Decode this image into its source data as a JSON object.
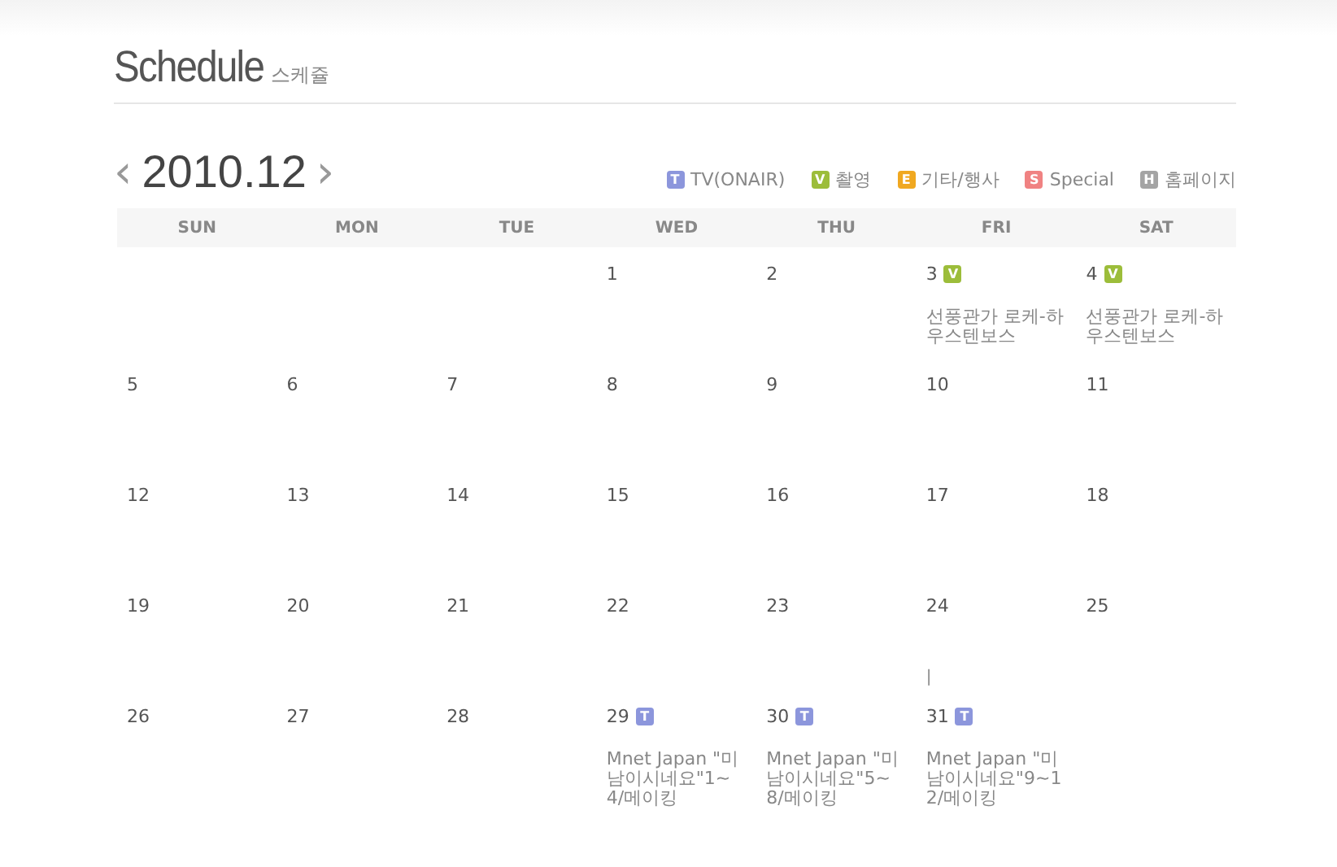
{
  "title": "Schedule",
  "subtitle": "스케쥴",
  "month": {
    "prev": "‹",
    "label": "2010.12",
    "next": "›"
  },
  "legend": [
    {
      "letter": "T",
      "label": "TV(ONAIR)",
      "color": "#8c96dc"
    },
    {
      "letter": "V",
      "label": "촬영",
      "color": "#9cbd3a"
    },
    {
      "letter": "E",
      "label": "기타/행사",
      "color": "#f0a820"
    },
    {
      "letter": "S",
      "label": "Special",
      "color": "#f08282"
    },
    {
      "letter": "H",
      "label": "홈페이지",
      "color": "#a4a4a4"
    }
  ],
  "weekdays": [
    "SUN",
    "MON",
    "TUE",
    "WED",
    "THU",
    "FRI",
    "SAT"
  ],
  "days": [
    {
      "day": "1"
    },
    {
      "day": "2"
    },
    {
      "day": "3",
      "badge": {
        "letter": "V",
        "color": "#9cbd3a"
      },
      "event": "선풍관가 로케-하우스텐보스"
    },
    {
      "day": "4",
      "badge": {
        "letter": "V",
        "color": "#9cbd3a"
      },
      "event": "선풍관가 로케-하우스텐보스"
    },
    {
      "day": "5"
    },
    {
      "day": "6"
    },
    {
      "day": "7"
    },
    {
      "day": "8"
    },
    {
      "day": "9"
    },
    {
      "day": "10"
    },
    {
      "day": "11"
    },
    {
      "day": "12"
    },
    {
      "day": "13"
    },
    {
      "day": "14"
    },
    {
      "day": "15"
    },
    {
      "day": "16"
    },
    {
      "day": "17"
    },
    {
      "day": "18"
    },
    {
      "day": "19"
    },
    {
      "day": "20"
    },
    {
      "day": "21"
    },
    {
      "day": "22"
    },
    {
      "day": "23"
    },
    {
      "day": "24",
      "note": "|"
    },
    {
      "day": "25"
    },
    {
      "day": "26"
    },
    {
      "day": "27"
    },
    {
      "day": "28"
    },
    {
      "day": "29",
      "badge": {
        "letter": "T",
        "color": "#8c96dc"
      },
      "event": "Mnet Japan \"미남이시네요\"1~4/메이킹"
    },
    {
      "day": "30",
      "badge": {
        "letter": "T",
        "color": "#8c96dc"
      },
      "event": "Mnet Japan \"미남이시네요\"5~8/메이킹"
    },
    {
      "day": "31",
      "badge": {
        "letter": "T",
        "color": "#8c96dc"
      },
      "event": "Mnet Japan \"미남이시네요\"9~12/메이킹"
    }
  ]
}
